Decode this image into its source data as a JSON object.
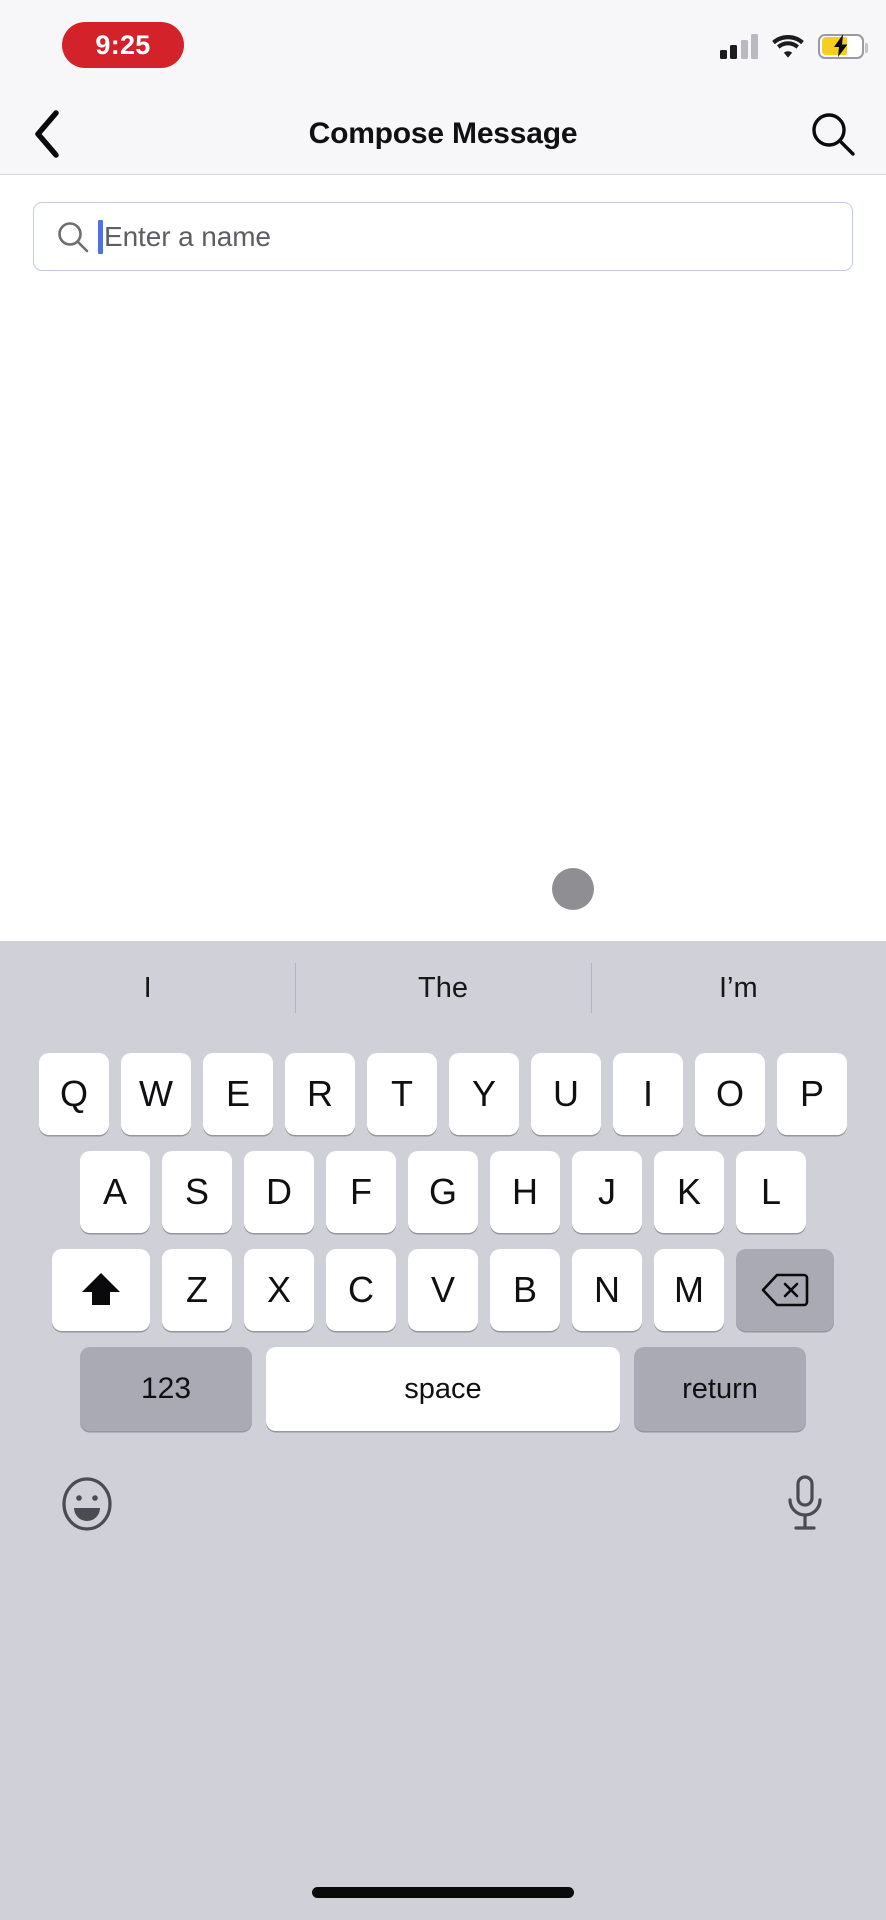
{
  "status_bar": {
    "time": "9:25",
    "time_pill_color": "#d3222a",
    "signal_icon": "cellular-signal-icon",
    "wifi_icon": "wifi-icon",
    "battery_icon": "battery-charging-icon",
    "battery_color": "#f5cf1e"
  },
  "nav": {
    "back_icon": "back-chevron-icon",
    "title": "Compose Message",
    "search_icon": "search-icon"
  },
  "recipient": {
    "search_icon": "search-icon",
    "placeholder": "Enter a name",
    "value": "",
    "caret_color": "#4b72e8",
    "border_color": "#c3cbe8"
  },
  "pointer": {
    "cursor_icon": "touch-pointer-dot",
    "color": "#8e8e93"
  },
  "keyboard": {
    "background": "#cfd0d8",
    "predictions": [
      "I",
      "The",
      "I’m"
    ],
    "row1": [
      "Q",
      "W",
      "E",
      "R",
      "T",
      "Y",
      "U",
      "I",
      "O",
      "P"
    ],
    "row2": [
      "A",
      "S",
      "D",
      "F",
      "G",
      "H",
      "J",
      "K",
      "L"
    ],
    "row3_letters": [
      "Z",
      "X",
      "C",
      "V",
      "B",
      "N",
      "M"
    ],
    "shift_icon": "shift-arrow-icon",
    "delete_icon": "backspace-delete-icon",
    "numbers_label": "123",
    "space_label": "space",
    "return_label": "return",
    "emoji_icon": "emoji-smiley-icon",
    "dictation_icon": "microphone-icon"
  }
}
